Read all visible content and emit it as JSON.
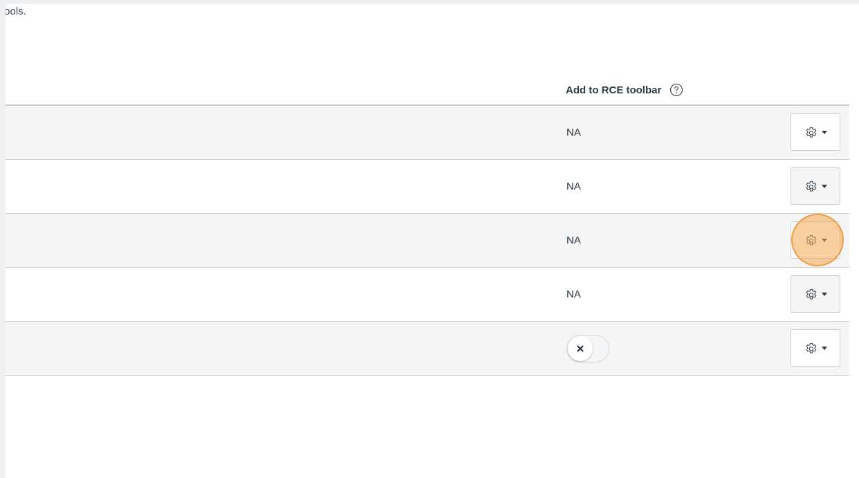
{
  "page": {
    "intro_text_fragment": "tools."
  },
  "table": {
    "header": {
      "rce_column": "Add to RCE toolbar",
      "help_icon": "question-circle-icon"
    },
    "rows": [
      {
        "rce_value": "NA",
        "action_icon": "gear-icon"
      },
      {
        "rce_value": "NA",
        "action_icon": "gear-icon"
      },
      {
        "rce_value": "NA",
        "action_icon": "gear-icon"
      },
      {
        "rce_value": "NA",
        "action_icon": "gear-icon"
      },
      {
        "rce_toggle": "off",
        "action_icon": "gear-icon"
      }
    ]
  },
  "colors": {
    "click_highlight": "#f6a752",
    "row_shade": "#f5f5f5",
    "border": "#c7cdd1",
    "text": "#2d3b45"
  }
}
